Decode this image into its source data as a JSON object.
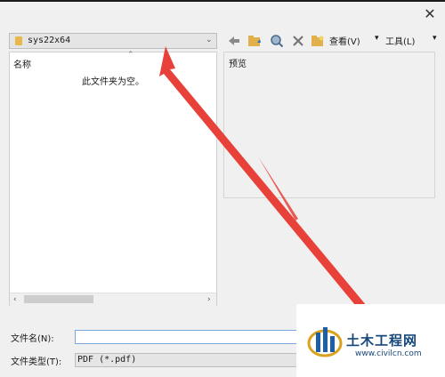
{
  "dialog": {
    "close_glyph": "✕"
  },
  "location": {
    "folder_name": "sys22x64",
    "icon": "folder-icon"
  },
  "toolbar": {
    "back_icon": "back-arrow-icon",
    "up_folder_icon": "up-folder-icon",
    "search_icon": "search-web-icon",
    "delete_icon": "delete-icon",
    "new_folder_icon": "new-folder-icon",
    "view_label": "查看(V)",
    "tools_label": "工具(L)"
  },
  "file_list": {
    "column_name": "名称",
    "empty_message": "此文件夹为空。"
  },
  "preview": {
    "label": "预览"
  },
  "form": {
    "filename_label": "文件名(N):",
    "filename_value": "",
    "filetype_label": "文件类型(T):",
    "filetype_value": "PDF (*.pdf)"
  },
  "watermark": {
    "title": "土木工程网",
    "url": "www.civilcn.com"
  },
  "colors": {
    "annotation_arrow": "#e8413a",
    "accent": "#16477a",
    "folder": "#e8b84a"
  }
}
